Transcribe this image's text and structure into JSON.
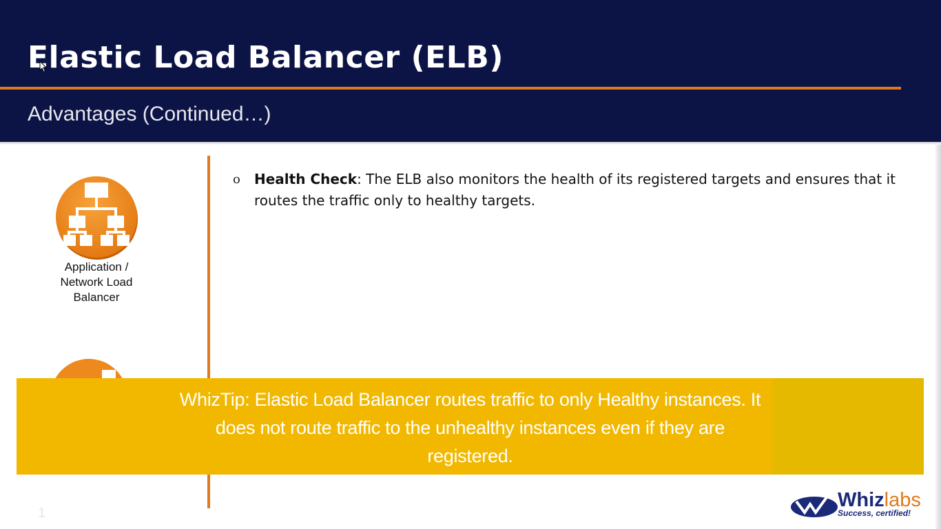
{
  "slide": {
    "title": "Elastic Load Balancer (ELB)",
    "subtitle": "Advantages (Continued…)",
    "page_number": "1"
  },
  "sidebar": {
    "icon": "load-balancer-icon",
    "caption_lines": [
      "Application /",
      "Network Load",
      "Balancer"
    ]
  },
  "content": {
    "bullet_marker": "o",
    "bullets": [
      {
        "term": "Health Check",
        "text": ": The ELB also monitors the health of its registered targets and ensures that it routes the traffic only to healthy targets."
      }
    ]
  },
  "tip": {
    "text": "WhizTip: Elastic Load Balancer routes traffic to only Healthy instances. It does not route traffic to the unhealthy instances even if they are registered."
  },
  "logo": {
    "brand_whiz": "Whiz",
    "brand_labs": "labs",
    "tagline": "Success, certified!"
  },
  "colors": {
    "header_bg": "#0c1446",
    "accent": "#e07a1c",
    "tip_bg": "#f2b800"
  }
}
